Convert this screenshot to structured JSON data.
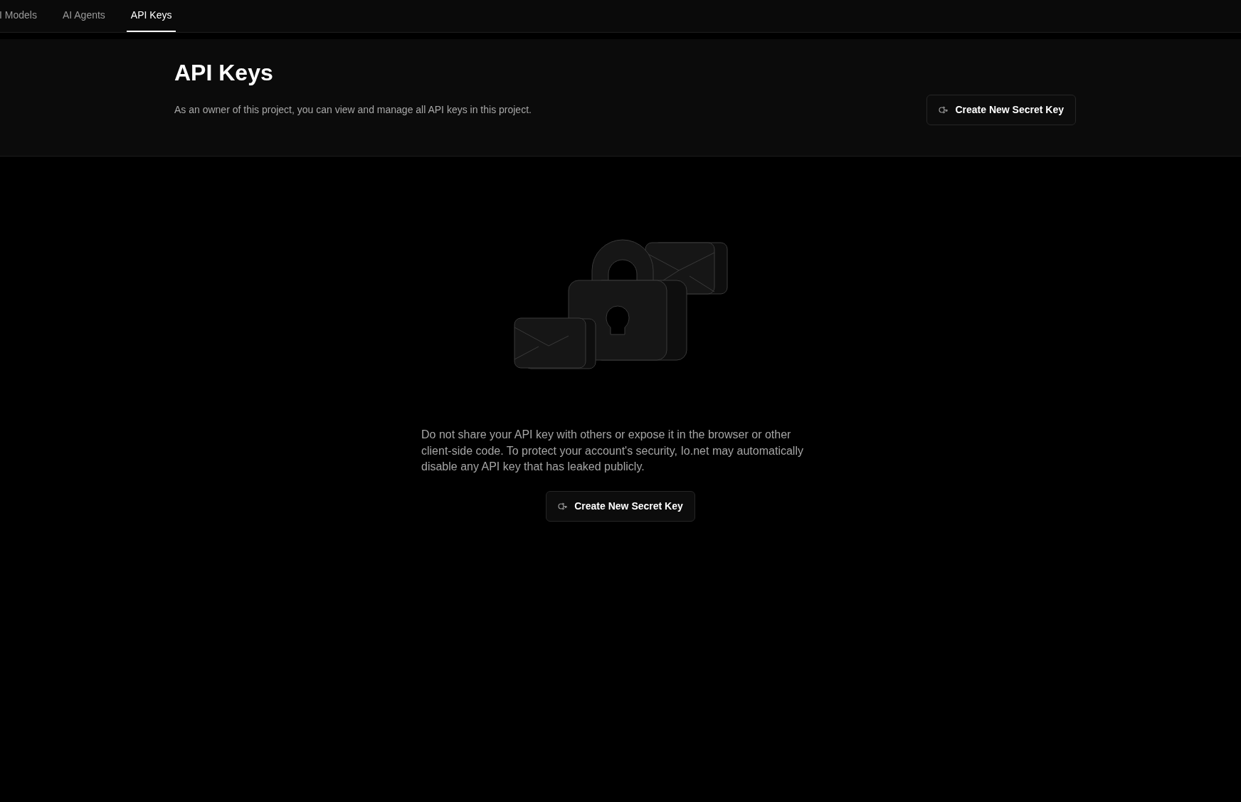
{
  "tabs": [
    {
      "label": "I Models",
      "selected": false
    },
    {
      "label": "AI Agents",
      "selected": false
    },
    {
      "label": "API Keys",
      "selected": true
    }
  ],
  "header": {
    "title": "API Keys",
    "description": "As an owner of this project, you can view and manage all API keys in this project.",
    "button": "Create New Secret Key"
  },
  "empty_state": {
    "message": "Do not share your API key with others or expose it in the browser or other client-side code. To protect your account's security, Io.net may automatically disable any API key that has leaked publicly.",
    "button": "Create New Secret Key"
  }
}
